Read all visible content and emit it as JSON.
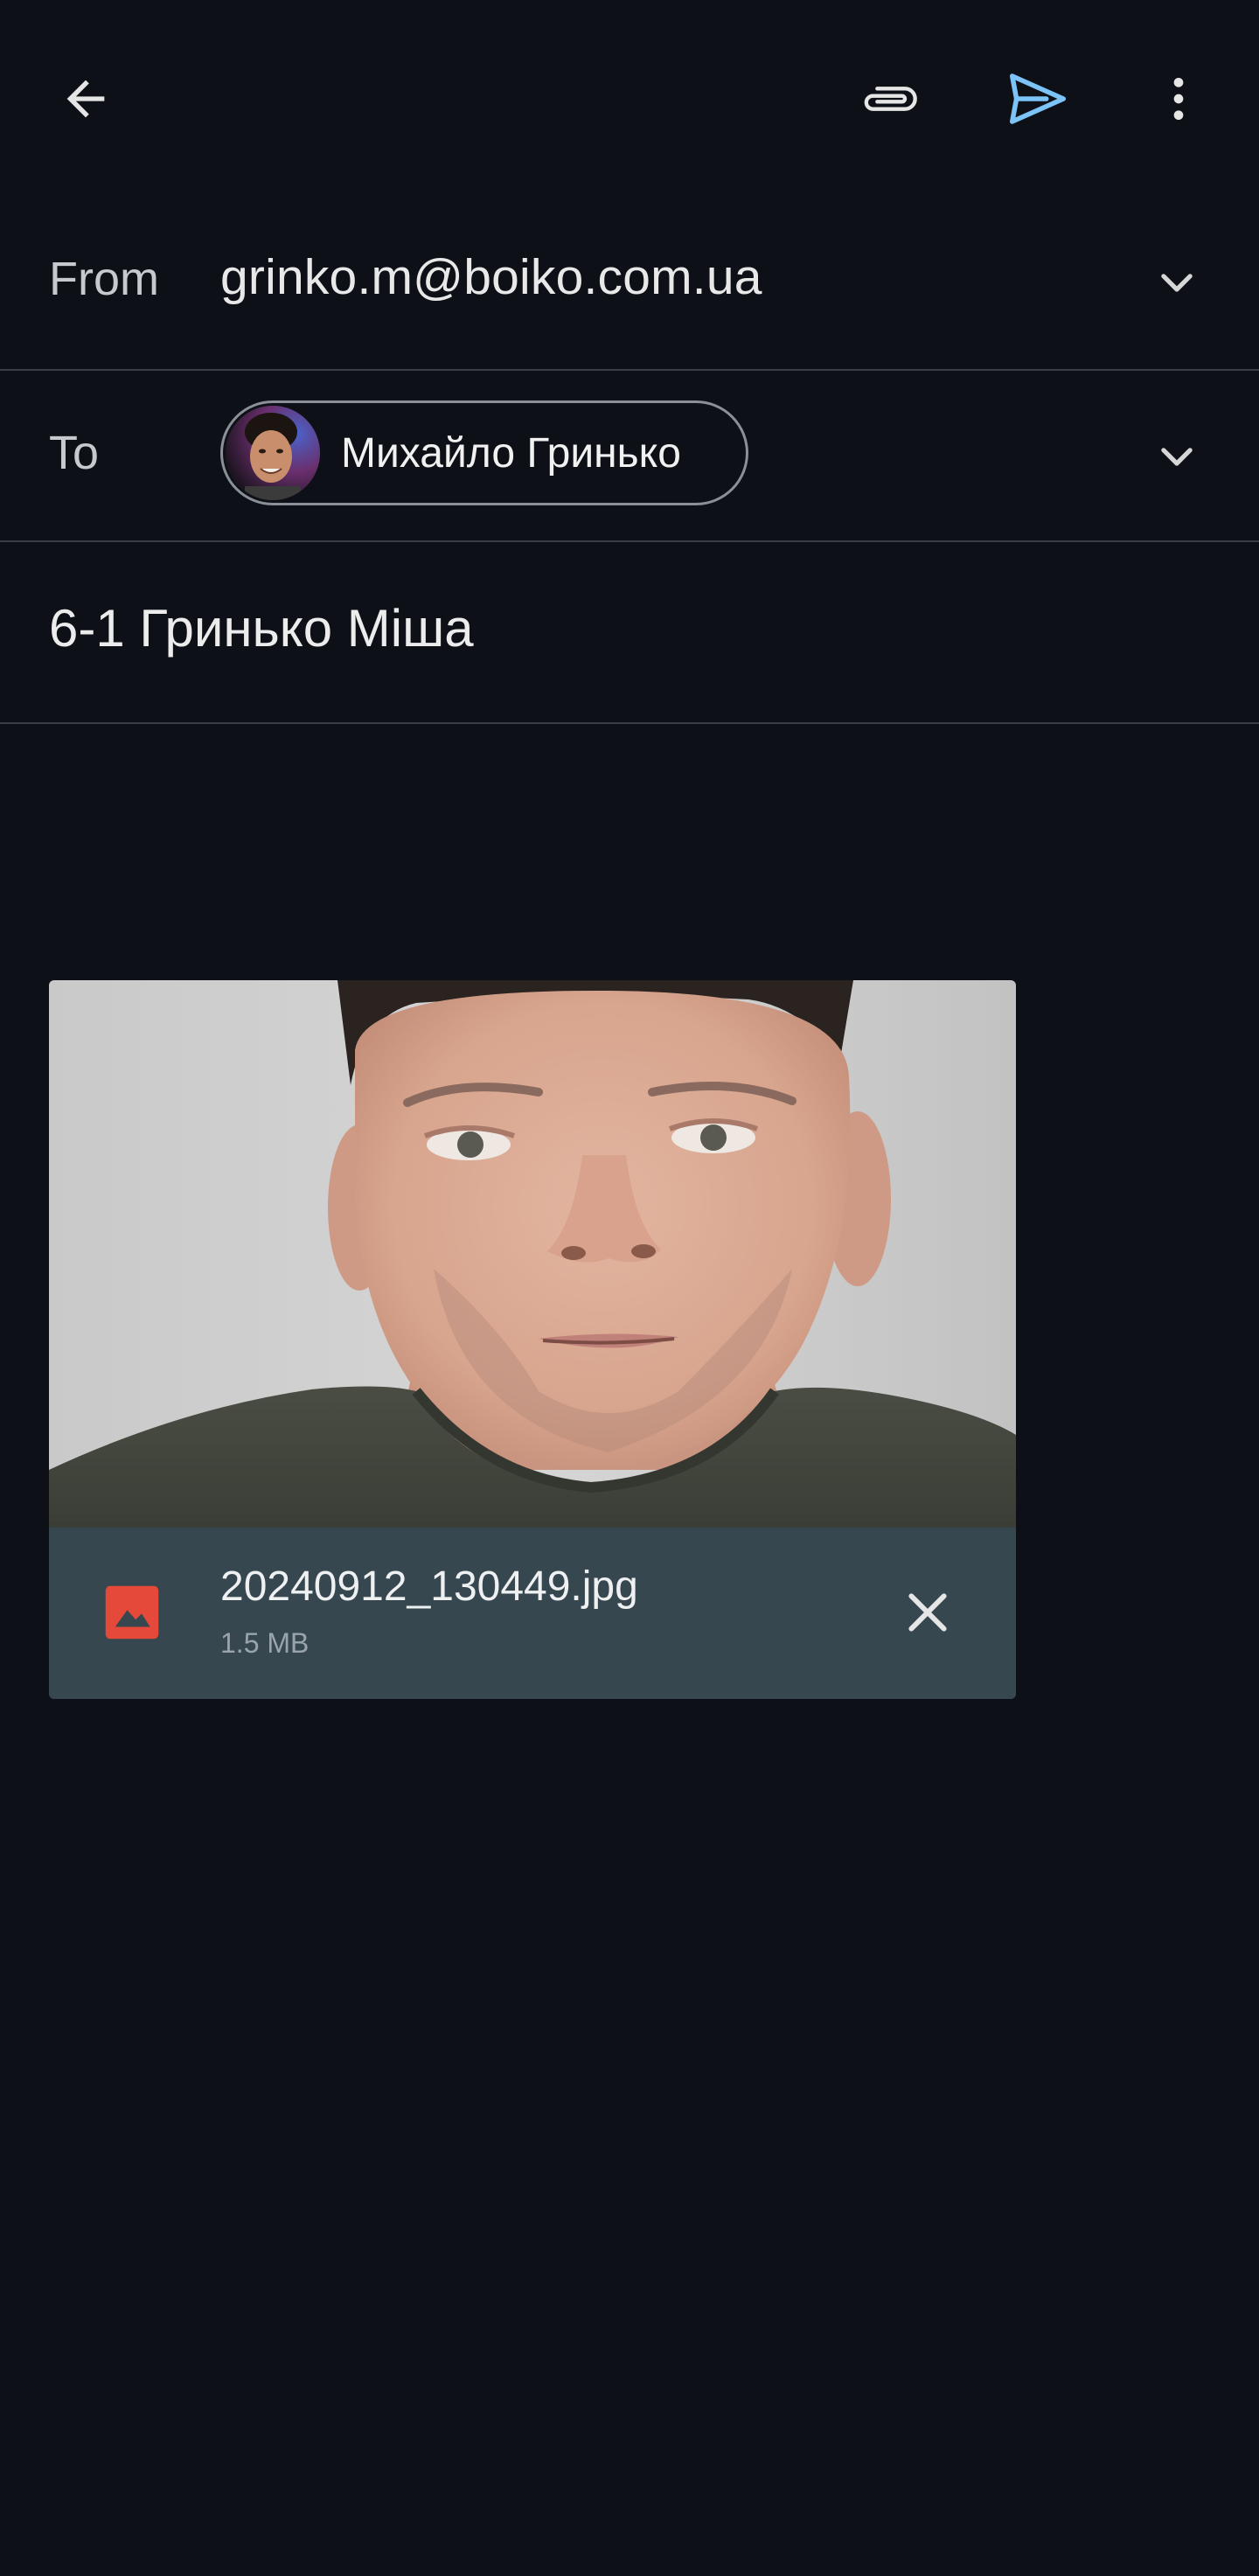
{
  "toolbar": {
    "back_icon": "arrow-back-icon",
    "attach_icon": "paperclip-icon",
    "send_icon": "send-icon",
    "more_icon": "more-vert-icon"
  },
  "from": {
    "label": "From",
    "value": "grinko.m@boiko.com.ua"
  },
  "to": {
    "label": "To",
    "recipient_name": "Михайло Гринько"
  },
  "subject": {
    "value": "6-1 Гринько Міша"
  },
  "attachment": {
    "file_name": "20240912_130449.jpg",
    "file_size": "1.5 MB",
    "icon": "image-file-icon"
  },
  "colors": {
    "background": "#0d1117",
    "send_accent": "#7cc4f8",
    "attachment_footer": "#37474f",
    "file_icon": "#e5493a",
    "divider": "#3a3f46"
  }
}
